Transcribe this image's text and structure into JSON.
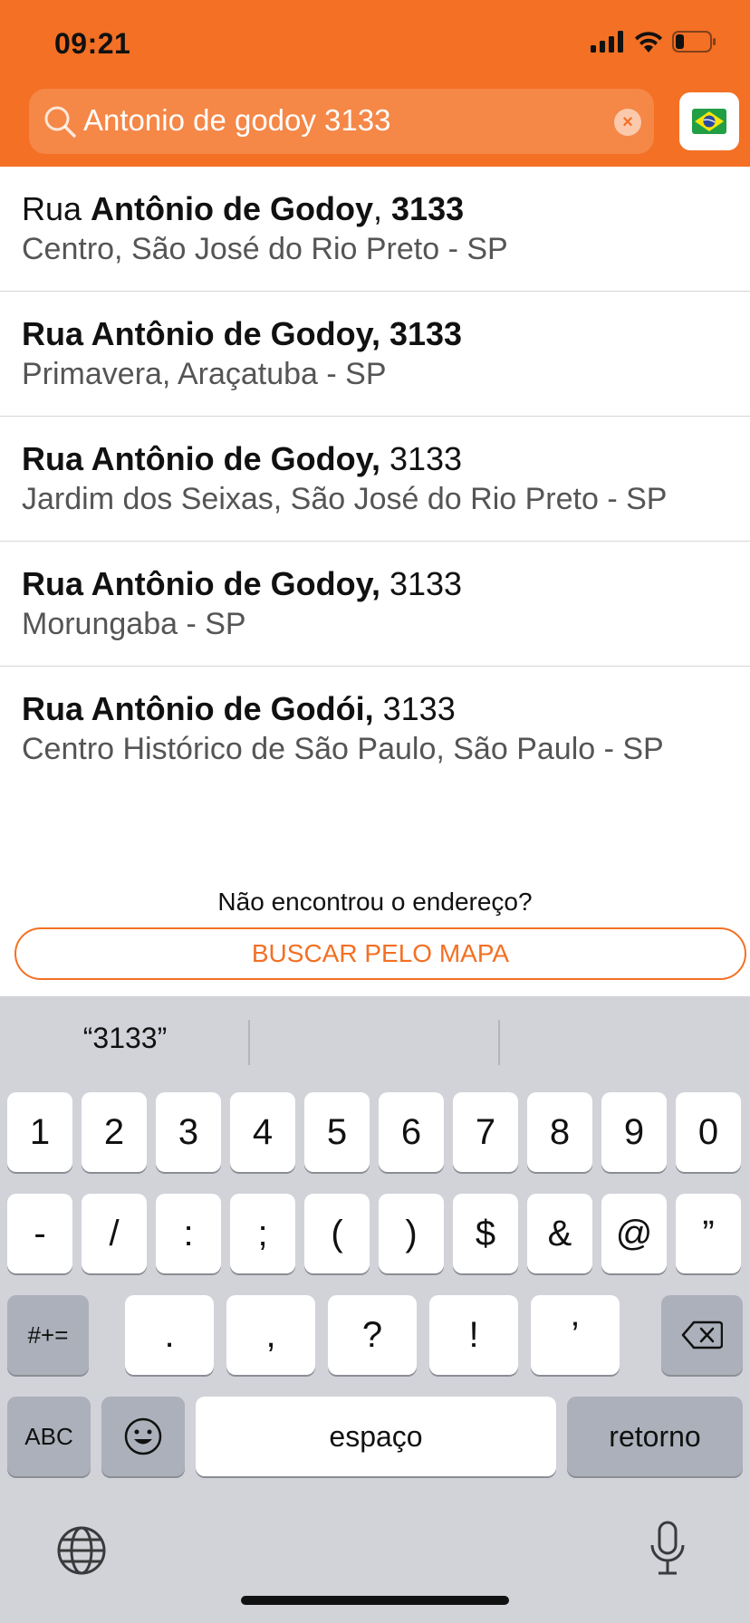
{
  "status_bar": {
    "time": "09:21"
  },
  "search": {
    "value": "Antonio de godoy 3133",
    "clear_label": "×"
  },
  "country_flag": "Brazil flag",
  "results": [
    {
      "prefix": "Rua ",
      "street": "Antônio de Godoy",
      "sep": ", ",
      "number": "3133",
      "number_bold": true,
      "detail": "Centro, São José do Rio Preto - SP"
    },
    {
      "prefix": "",
      "street": "Rua Antônio de Godoy",
      "sep": ", ",
      "number": "3133",
      "number_bold": true,
      "detail": "Primavera, Araçatuba - SP"
    },
    {
      "prefix": "",
      "street": "Rua Antônio de Godoy,",
      "sep": " ",
      "number": "3133",
      "number_bold": false,
      "detail": "Jardim dos Seixas, São José do Rio Preto - SP"
    },
    {
      "prefix": "",
      "street": "Rua Antônio de Godoy,",
      "sep": " ",
      "number": "3133",
      "number_bold": false,
      "detail": "Morungaba - SP"
    },
    {
      "prefix": "",
      "street": "Rua Antônio de Godói,",
      "sep": " ",
      "number": "3133",
      "number_bold": false,
      "detail": "Centro Histórico de São Paulo, São Paulo - SP"
    }
  ],
  "not_found_text": "Não encontrou o endereço?",
  "map_button_label": "BUSCAR PELO MAPA",
  "keyboard": {
    "suggestions": [
      "“3133”",
      "",
      ""
    ],
    "row1": [
      "1",
      "2",
      "3",
      "4",
      "5",
      "6",
      "7",
      "8",
      "9",
      "0"
    ],
    "row2": [
      "-",
      "/",
      ":",
      ";",
      "(",
      ")",
      "$",
      "&",
      "@",
      "”"
    ],
    "row3": [
      ".",
      ",",
      "?",
      "!",
      "’"
    ],
    "symbols_key": "#+=",
    "abc_key": "ABC",
    "space_key": "espaço",
    "return_key": "retorno"
  },
  "colors": {
    "accent": "#F37024",
    "keyboard_bg": "#D1D3D9"
  },
  "icons": [
    "signal-icon",
    "wifi-icon",
    "battery-icon",
    "search-icon",
    "clear-icon",
    "brazil-flag-icon",
    "backspace-icon",
    "emoji-icon",
    "globe-icon",
    "microphone-icon"
  ]
}
